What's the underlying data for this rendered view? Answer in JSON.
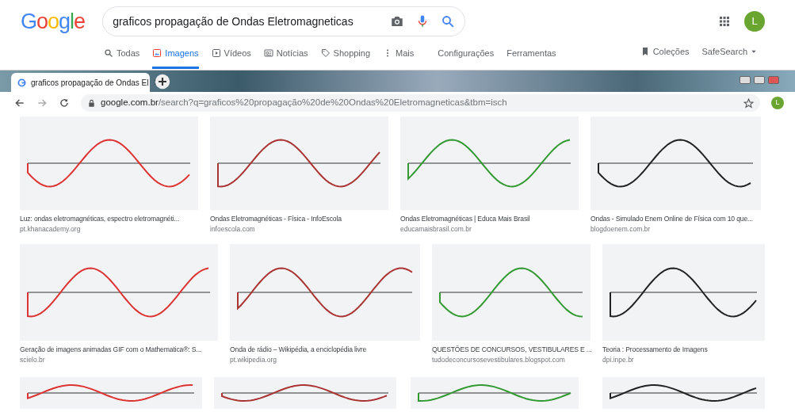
{
  "google": {
    "logo": "Google",
    "query": "graficos propagação de Ondas Eletromagneticas",
    "avatar": "L",
    "tabs": [
      {
        "label": "Todas",
        "selected": false
      },
      {
        "label": "Imagens",
        "selected": true
      },
      {
        "label": "Vídeos",
        "selected": false
      },
      {
        "label": "Notícias",
        "selected": false
      },
      {
        "label": "Shopping",
        "selected": false
      },
      {
        "label": "Mais",
        "selected": false
      },
      {
        "label": "Configurações",
        "selected": false
      },
      {
        "label": "Ferramentas",
        "selected": false
      }
    ],
    "collections": "Coleções",
    "safesearch": "SafeSearch"
  },
  "browser": {
    "tab_title": "graficos propagação de Ondas El",
    "url_host": "google.com.br",
    "url_path": "/search?q=graficos%20propagação%20de%20Ondas%20Eletromagneticas&tbm=isch",
    "avatar": "L"
  },
  "results": [
    [
      {
        "title": "Luz: ondas eletromagnéticas, espectro eletromagnéti...",
        "source": "pt.khanacademy.org"
      },
      {
        "title": "Ondas Eletromagnéticas - Física - InfoEscola",
        "source": "infoescola.com"
      },
      {
        "title": "Ondas Eletromagnéticas | Educa Mais Brasil",
        "source": "educamaisbrasil.com.br"
      },
      {
        "title": "Ondas - Simulado Enem Online de Física com 10 que...",
        "source": "blogdoenem.com.br"
      }
    ],
    [
      {
        "title": "Geração de imagens animadas GIF com o Mathematica®: S...",
        "source": "scielo.br"
      },
      {
        "title": "Onda de rádio – Wikipédia, a enciclopédia livre",
        "source": "pt.wikipedia.org"
      },
      {
        "title": "QUESTÕES DE CONCURSOS, VESTIBULARES E ...",
        "source": "tudodeconcursosevestibulares.blogspot.com"
      },
      {
        "title": "Teoria : Processamento de Imagens",
        "source": "dpi.inpe.br"
      }
    ]
  ]
}
